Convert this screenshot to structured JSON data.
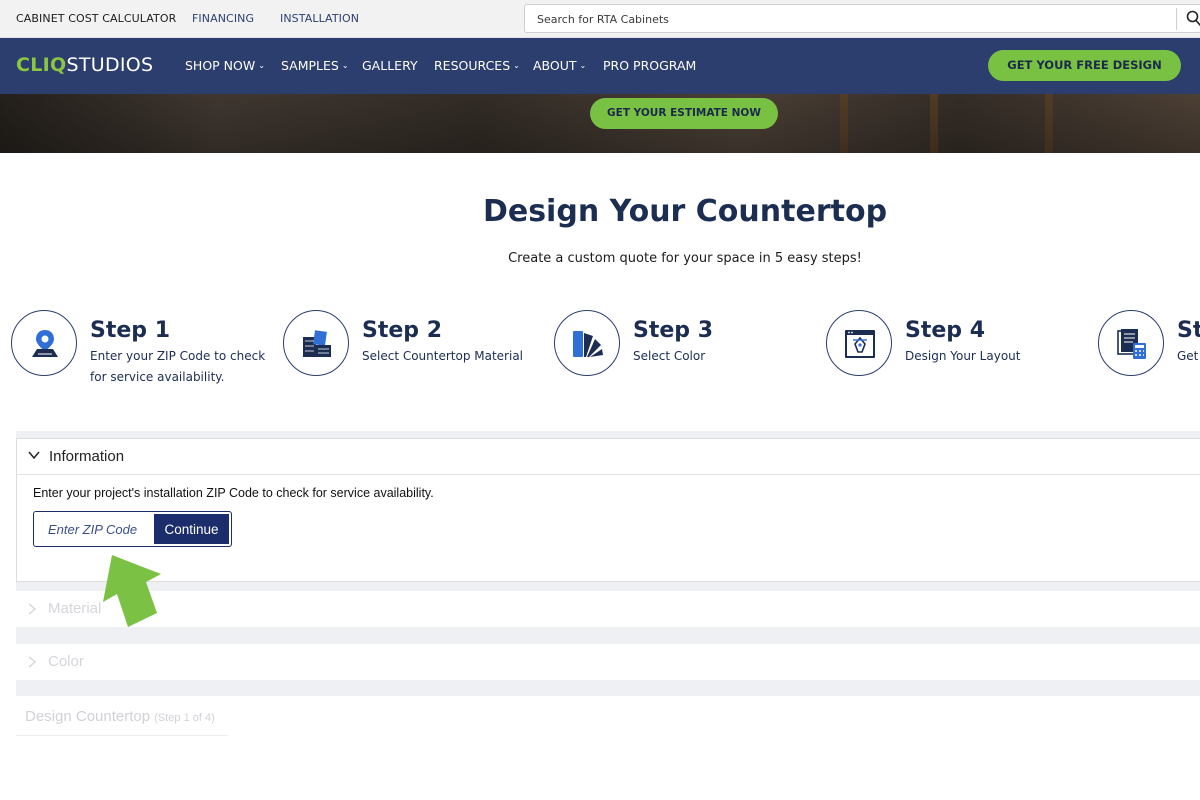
{
  "utility_bar": {
    "links": [
      "CABINET COST CALCULATOR",
      "FINANCING",
      "INSTALLATION"
    ],
    "search_placeholder": "Search for RTA Cabinets"
  },
  "nav": {
    "logo_cliq": "CLIQ",
    "logo_studios": "STUDIOS",
    "items": [
      {
        "label": "SHOP NOW",
        "dropdown": true
      },
      {
        "label": "SAMPLES",
        "dropdown": true
      },
      {
        "label": "GALLERY",
        "dropdown": false
      },
      {
        "label": "RESOURCES",
        "dropdown": true
      },
      {
        "label": "ABOUT",
        "dropdown": true
      },
      {
        "label": "PRO PROGRAM",
        "dropdown": false
      }
    ],
    "cta_label": "GET YOUR FREE DESIGN"
  },
  "hero": {
    "cta_label": "GET YOUR ESTIMATE NOW"
  },
  "page": {
    "title": "Design Your Countertop",
    "subtitle": "Create a custom quote for your space in 5 easy steps!"
  },
  "steps": [
    {
      "title": "Step 1",
      "desc_line1": "Enter your ZIP Code to check",
      "desc_line2": "for service availability.",
      "icon": "location-pin-icon"
    },
    {
      "title": "Step 2",
      "desc_line1": "Select Countertop Material",
      "desc_line2": "",
      "icon": "material-tiles-icon"
    },
    {
      "title": "Step 3",
      "desc_line1": "Select Color",
      "desc_line2": "",
      "icon": "color-swatch-icon"
    },
    {
      "title": "Step 4",
      "desc_line1": "Design Your Layout",
      "desc_line2": "",
      "icon": "design-pen-icon"
    },
    {
      "title": "St",
      "desc_line1": "Get",
      "desc_line2": "",
      "icon": "quote-calculator-icon"
    }
  ],
  "accordion": {
    "information": {
      "title": "Information",
      "body": "Enter your project's installation ZIP Code to check for service availability.",
      "zip_placeholder": "Enter ZIP Code",
      "continue_label": "Continue"
    },
    "material_title": "Material",
    "color_title": "Color",
    "design_title": "Design Countertop",
    "design_step": "(Step 1 of 4)"
  },
  "colors": {
    "navy": "#2b3e6e",
    "brand_green": "#79c142",
    "button_navy": "#1c2d6b"
  }
}
